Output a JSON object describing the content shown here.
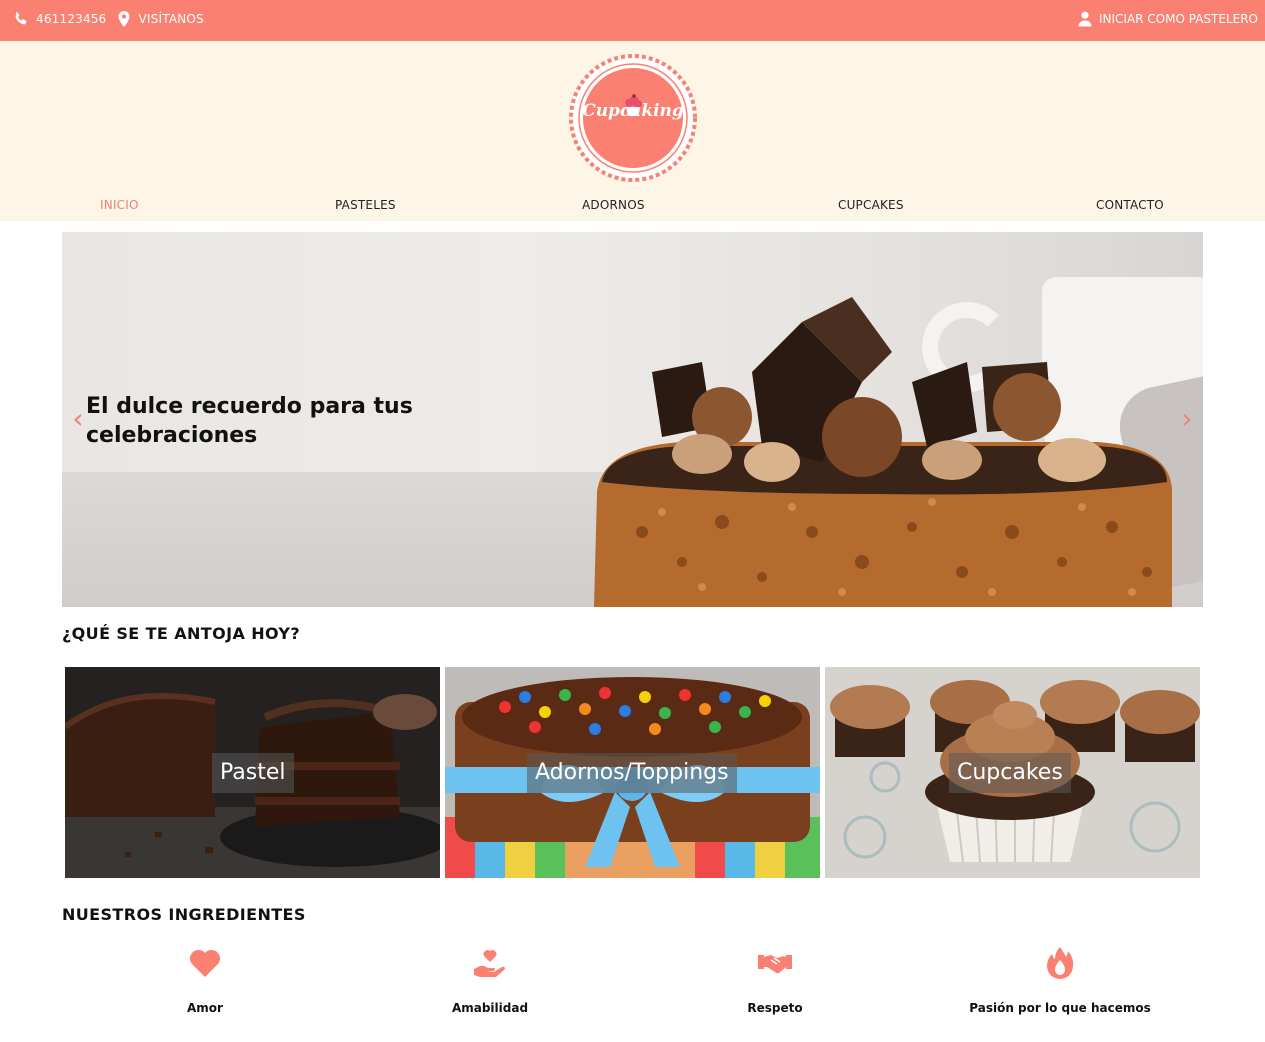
{
  "topbar": {
    "phone": "461123456",
    "visit": "VISÍTANOS",
    "login": "INICIAR COMO PASTELERO",
    "phone_icon": "phone-icon",
    "location_icon": "map-pin-icon",
    "user_icon": "user-icon"
  },
  "brand": {
    "logo_text": "Cupcaking"
  },
  "nav": [
    {
      "label": "INICIO",
      "active": true
    },
    {
      "label": "PASTELES",
      "active": false
    },
    {
      "label": "ADORNOS",
      "active": false
    },
    {
      "label": "CUPCAKES",
      "active": false
    },
    {
      "label": "CONTACTO",
      "active": false
    }
  ],
  "hero": {
    "caption": "El dulce recuerdo para tus celebraciones",
    "prev_icon": "chevron-left-icon",
    "next_icon": "chevron-right-icon"
  },
  "craving": {
    "title": "¿QUÉ SE TE ANTOJA HOY?",
    "cards": [
      {
        "label": "Pastel"
      },
      {
        "label": "Adornos/Toppings"
      },
      {
        "label": "Cupcakes"
      }
    ]
  },
  "ingredients": {
    "title": "NUESTROS INGREDIENTES",
    "items": [
      {
        "label": "Amor",
        "icon": "heart-icon"
      },
      {
        "label": "Amabilidad",
        "icon": "hand-holding-heart-icon"
      },
      {
        "label": "Respeto",
        "icon": "handshake-icon"
      },
      {
        "label": "Pasión por lo que hacemos",
        "icon": "fire-icon"
      }
    ]
  },
  "colors": {
    "accent": "#fa8072",
    "header_bg": "#fdf5e6",
    "active_nav": "#f0807a"
  }
}
